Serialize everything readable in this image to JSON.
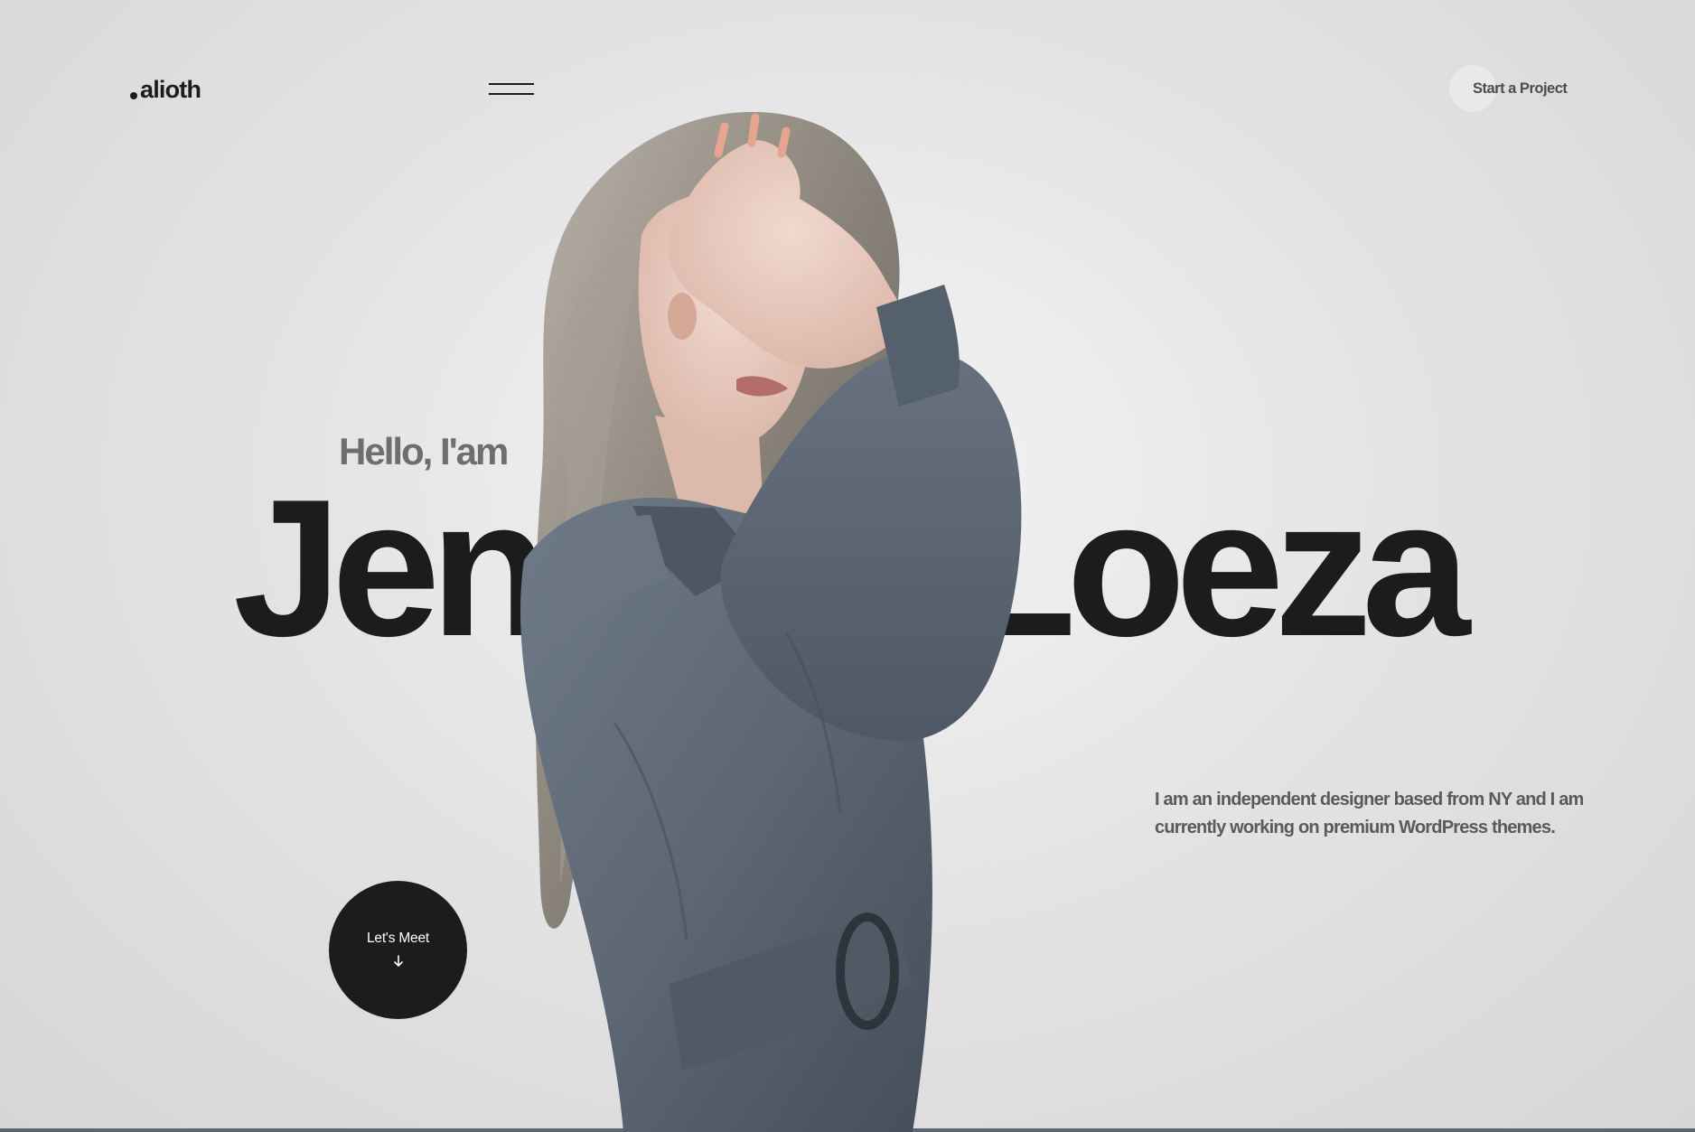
{
  "header": {
    "logo": "alioth",
    "cta_label": "Start a Project"
  },
  "hero": {
    "greeting": "Hello, I'am",
    "name": "Jennifer Loeza",
    "bio": "I am an independent designer based from NY and I am currently working on premium WordPress themes.",
    "meet_label": "Let's Meet"
  },
  "icons": {
    "menu": "hamburger-menu-icon",
    "arrow": "arrow-down-icon",
    "logo_dot": "dot-icon"
  },
  "colors": {
    "background": "#e3e3e3",
    "primary_text": "#1b1c1e",
    "muted_text": "#6e6e6e",
    "button_bg": "#1b1c1e",
    "jacket": "#5d6775"
  }
}
